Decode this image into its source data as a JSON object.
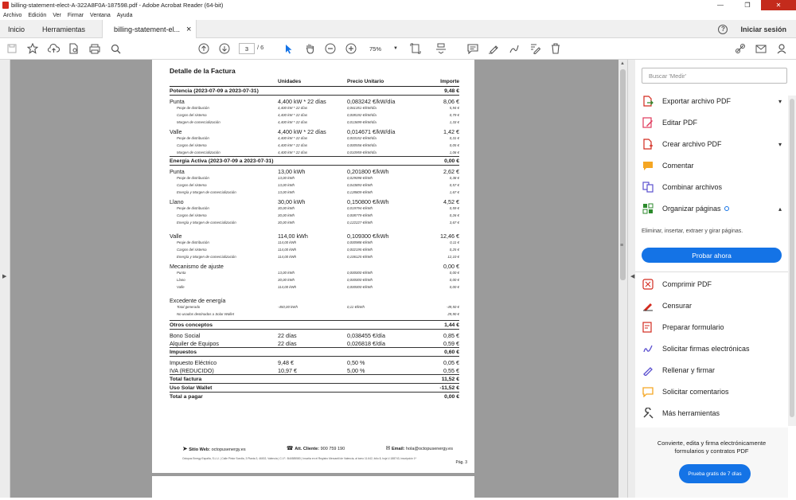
{
  "window": {
    "title": "billing-statement-elect-A-322A8F0A-187598.pdf - Adobe Acrobat Reader (64-bit)",
    "minimize": "—",
    "maximize": "❐",
    "close": "✕"
  },
  "menu": [
    "Archivo",
    "Edición",
    "Ver",
    "Firmar",
    "Ventana",
    "Ayuda"
  ],
  "tabs": {
    "home": "Inicio",
    "tools": "Herramientas",
    "doc": "billing-statement-el...",
    "doc_close": "×",
    "signin": "Iniciar sesión"
  },
  "toolbar": {
    "page_current": "3",
    "page_total": "/ 6",
    "zoom": "75%"
  },
  "invoice": {
    "title": "Detalle de la Factura",
    "headers": [
      "Unidades",
      "Precio Unitario",
      "Importe"
    ],
    "potencia": {
      "label": "Potencia (2023-07-09 a 2023-07-31)",
      "amount": "9,48 €",
      "punta": {
        "label": "Punta",
        "units": "4,400 kW * 22 días",
        "price": "0,083242 €/kW/día",
        "amount": "8,06 €",
        "subs": [
          {
            "label": "Peaje de distribución",
            "units": "4,400 kW * 22 días",
            "price": "0,061351 €/kW/día",
            "amount": "5,94 €"
          },
          {
            "label": "Cargos del sistema",
            "units": "4,400 kW * 22 días",
            "price": "0,008192 €/kW/día",
            "amount": "0,79 €"
          },
          {
            "label": "Margen de comercialización",
            "units": "4,400 kW * 22 días",
            "price": "0,013699 €/kW/día",
            "amount": "1,33 €"
          }
        ]
      },
      "valle": {
        "label": "Valle",
        "units": "4,400 kW * 22 días",
        "price": "0,014671 €/kW/día",
        "amount": "1,42 €",
        "subs": [
          {
            "label": "Peaje de distribución",
            "units": "4,400 kW * 22 días",
            "price": "0,003152 €/kW/día",
            "amount": "0,31 €"
          },
          {
            "label": "Cargos del sistema",
            "units": "4,400 kW * 22 días",
            "price": "0,000556 €/kW/día",
            "amount": "0,05 €"
          },
          {
            "label": "Margen de comercialización",
            "units": "4,400 kW * 22 días",
            "price": "0,010959 €/kW/día",
            "amount": "1,06 €"
          }
        ]
      }
    },
    "energia": {
      "label": "Energía Activa (2023-07-09 a 2023-07-31)",
      "amount": "0,00 €",
      "punta": {
        "label": "Punta",
        "units": "13,00 kWh",
        "price": "0,201800 €/kWh",
        "amount": "2,62 €",
        "subs": [
          {
            "label": "Peaje de distribución",
            "units": "13,00 kWh",
            "price": "0,029098 €/kWh",
            "amount": "0,38 €"
          },
          {
            "label": "Cargos del sistema",
            "units": "13,00 kWh",
            "price": "0,043893 €/kWh",
            "amount": "0,57 €"
          },
          {
            "label": "Energía y Margen de comercialización",
            "units": "13,00 kWh",
            "price": "0,128809 €/kWh",
            "amount": "1,67 €"
          }
        ]
      },
      "llano": {
        "label": "Llano",
        "units": "30,00 kWh",
        "price": "0,150800 €/kWh",
        "amount": "4,52 €",
        "subs": [
          {
            "label": "Peaje de distribución",
            "units": "30,00 kWh",
            "price": "0,019794 €/kWh",
            "amount": "0,59 €"
          },
          {
            "label": "Cargos del sistema",
            "units": "30,00 kWh",
            "price": "0,008779 €/kWh",
            "amount": "0,26 €"
          },
          {
            "label": "Energía y Margen de comercialización",
            "units": "30,00 kWh",
            "price": "0,122227 €/kWh",
            "amount": "3,67 €"
          }
        ]
      },
      "valle": {
        "label": "Valle",
        "units": "114,00 kWh",
        "price": "0,109300 €/kWh",
        "amount": "12,46 €",
        "subs": [
          {
            "label": "Peaje de distribución",
            "units": "114,00 kWh",
            "price": "0,000988 €/kWh",
            "amount": "0,11 €"
          },
          {
            "label": "Cargos del sistema",
            "units": "114,00 kWh",
            "price": "0,002195 €/kWh",
            "amount": "0,25 €"
          },
          {
            "label": "Energía y Margen de comercialización",
            "units": "114,00 kWh",
            "price": "0,106125 €/kWh",
            "amount": "12,10 €"
          }
        ]
      },
      "ajuste": {
        "label": "Mecanismo de ajuste",
        "amount": "0,00 €",
        "subs": [
          {
            "label": "Punta",
            "units": "13,00 kWh",
            "price": "0,000000 €/kWh",
            "amount": "0,00 €"
          },
          {
            "label": "Llano",
            "units": "30,00 kWh",
            "price": "0,000000 €/kWh",
            "amount": "0,00 €"
          },
          {
            "label": "Valle",
            "units": "114,00 kWh",
            "price": "0,000000 €/kWh",
            "amount": "0,00 €"
          }
        ]
      },
      "excedente": {
        "label": "Excedente de energía",
        "subs": [
          {
            "label": "Total generado",
            "units": "-450,00 kWh",
            "price": "0,11 €/kWh",
            "amount": "-49,50 €"
          },
          {
            "label": "No usados destinados a Solar Wallet",
            "units": "",
            "price": "",
            "amount": "29,90 €"
          }
        ]
      }
    },
    "otros": {
      "label": "Otros conceptos",
      "amount": "1,44 €",
      "rows": [
        {
          "label": "Bono Social",
          "units": "22 días",
          "price": "0,038455 €/día",
          "amount": "0,85 €"
        },
        {
          "label": "Alquiler de Equipos",
          "units": "22 días",
          "price": "0,026818 €/día",
          "amount": "0,59 €"
        }
      ]
    },
    "impuestos": {
      "label": "Impuestos",
      "amount": "0,60 €",
      "rows": [
        {
          "label": "Impuesto Eléctrico",
          "units": "9,48 €",
          "price": "0,50 %",
          "amount": "0,05 €"
        },
        {
          "label": "IVA (REDUCIDO)",
          "units": "10,97 €",
          "price": "5,00 %",
          "amount": "0,55 €"
        }
      ]
    },
    "totals": [
      {
        "label": "Total factura",
        "amount": "11,52 €"
      },
      {
        "label": "Uso Solar Wallet",
        "amount": "-11,52 €"
      },
      {
        "label": "Total a pagar",
        "amount": "0,00 €"
      }
    ],
    "footer": {
      "web_label": "Sitio Web:",
      "web": "octopusenergy.es",
      "phone_label": "Att. Cliente:",
      "phone": "900 759 190",
      "email_label": "Email:",
      "email": "hola@octopusenergy.es",
      "legal": "Octopus Energy España, S.L.U. | Calle Pintor Sorolla, 3 Planta 3, 46002, Valencia | C.I.F.: B44585580 | Inscrita en el Registro Mercantil de Valencia, al tomo 11.642, folio 8, hoja V-188743, inscripción 1ª",
      "page": "Pág. 3"
    }
  },
  "panel": {
    "search_placeholder": "Buscar 'Medir'",
    "items": [
      {
        "label": "Exportar archivo PDF",
        "color": "#d32a1e"
      },
      {
        "label": "Editar PDF",
        "color": "#e0385b"
      },
      {
        "label": "Crear archivo PDF",
        "color": "#d32a1e"
      },
      {
        "label": "Comentar",
        "color": "#f5a623"
      },
      {
        "label": "Combinar archivos",
        "color": "#5a4fcf"
      },
      {
        "label": "Organizar páginas",
        "color": "#2c8a2c"
      }
    ],
    "organize_desc": "Eliminar, insertar, extraer y girar páginas.",
    "organize_button": "Probar ahora",
    "items2": [
      {
        "label": "Comprimir PDF",
        "color": "#d32a1e"
      },
      {
        "label": "Censurar",
        "color": "#d32a1e"
      },
      {
        "label": "Preparar formulario",
        "color": "#d32a1e"
      },
      {
        "label": "Solicitar firmas electrónicas",
        "color": "#5a4fcf"
      },
      {
        "label": "Rellenar y firmar",
        "color": "#5a4fcf"
      },
      {
        "label": "Solicitar comentarios",
        "color": "#f5a623"
      },
      {
        "label": "Más herramientas",
        "color": "#444444"
      }
    ],
    "promo_text": "Convierte, edita y firma electrónicamente formularios y contratos PDF",
    "promo_button": "Prueba gratis de 7 días"
  }
}
